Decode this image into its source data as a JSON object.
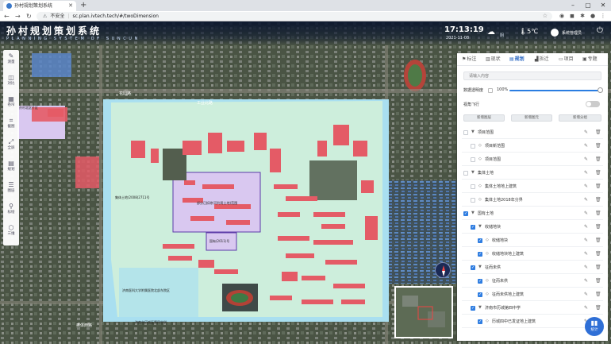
{
  "browser": {
    "tab_title": "孙村规划策划系统",
    "security_label": "不安全",
    "url": "sc.plan.ivtech.tech/#/twoDimension"
  },
  "header": {
    "title": "孙村规划策划系统",
    "subtitle": "PLANNING SYSTEM OF SUNCUN",
    "time": "17:13:19",
    "date": "2021-11-08",
    "weather_label": "阴",
    "temperature": "5℃",
    "user": "系统管理员"
  },
  "left_toolbar": [
    {
      "label": "测量",
      "icon": "ruler-icon",
      "glyph": "✎"
    },
    {
      "label": "对比",
      "icon": "split-icon",
      "glyph": "◫"
    },
    {
      "label": "卷帘",
      "icon": "grid-icon",
      "glyph": "▦"
    },
    {
      "label": "截图",
      "icon": "crop-icon",
      "glyph": "⌗"
    },
    {
      "label": "全屏",
      "icon": "fullscreen-icon",
      "glyph": "⤢"
    },
    {
      "label": "规划",
      "icon": "book-icon",
      "glyph": "▤"
    },
    {
      "label": "图层",
      "icon": "layers-icon",
      "glyph": "☰"
    },
    {
      "label": "标绘",
      "icon": "pin-icon",
      "glyph": "⚲"
    },
    {
      "label": "三维",
      "icon": "cube-icon",
      "glyph": "⬡"
    }
  ],
  "panel": {
    "tabs": [
      {
        "label": "标注",
        "icon": "flag-icon",
        "glyph": "⚑"
      },
      {
        "label": "现状",
        "icon": "chart-icon",
        "glyph": "▥"
      },
      {
        "label": "规划",
        "icon": "plan-icon",
        "glyph": "▤"
      },
      {
        "label": "拆迁",
        "icon": "building-icon",
        "glyph": "▟"
      },
      {
        "label": "项目",
        "icon": "folder-icon",
        "glyph": "▭"
      },
      {
        "label": "专题",
        "icon": "topic-icon",
        "glyph": "▣"
      }
    ],
    "active_tab": "规划",
    "search_placeholder": "请输入内容",
    "opacity_label": "数据透明度",
    "opacity_value": "100%",
    "flight_label": "视角飞行",
    "buttons": [
      "新增图层",
      "新增图元",
      "新增分组"
    ],
    "tree": [
      {
        "label": "项目范围",
        "level": 0,
        "checked": false,
        "expanded": true
      },
      {
        "label": "项目新范围",
        "level": 1,
        "checked": false
      },
      {
        "label": "项目范围",
        "level": 1,
        "checked": false
      },
      {
        "label": "集体土地",
        "level": 0,
        "checked": false,
        "expanded": true
      },
      {
        "label": "集体土地地上建筑",
        "level": 1,
        "checked": false
      },
      {
        "label": "集体土地2018年分界",
        "level": 1,
        "checked": false
      },
      {
        "label": "国有土地",
        "level": 0,
        "checked": true,
        "expanded": true
      },
      {
        "label": "收储地块",
        "level": 1,
        "checked": true,
        "expanded": true
      },
      {
        "label": "收储地块",
        "level": 2,
        "checked": true
      },
      {
        "label": "收储地块地上建筑",
        "level": 2,
        "checked": true
      },
      {
        "label": "征而未供",
        "level": 1,
        "checked": true,
        "expanded": true
      },
      {
        "label": "征而未供",
        "level": 2,
        "checked": true
      },
      {
        "label": "征而未供地上建筑",
        "level": 2,
        "checked": true
      },
      {
        "label": "济南市历城第四中学",
        "level": 1,
        "checked": true,
        "expanded": true
      },
      {
        "label": "历城四中已发证地上建筑",
        "level": 2,
        "checked": true
      }
    ]
  },
  "map": {
    "road_labels": [
      "花园路",
      "工业北路",
      "奥体西路"
    ],
    "parcel_labels": [
      "孙村北区片区",
      "集体土地(2008)2711号",
      "部分已拆除(可利用土地)范围",
      "国有(2011)号",
      "济南医科大学附属医院北部东院区",
      "济南市历城区第四中学"
    ],
    "stats_label": "统计"
  },
  "colors": {
    "accent": "#2f7de1",
    "parcel_green": "#cdeedc",
    "parcel_red": "#e45b66",
    "parcel_purple": "#d9c8f0",
    "parcel_cyan": "#a9dff0"
  }
}
